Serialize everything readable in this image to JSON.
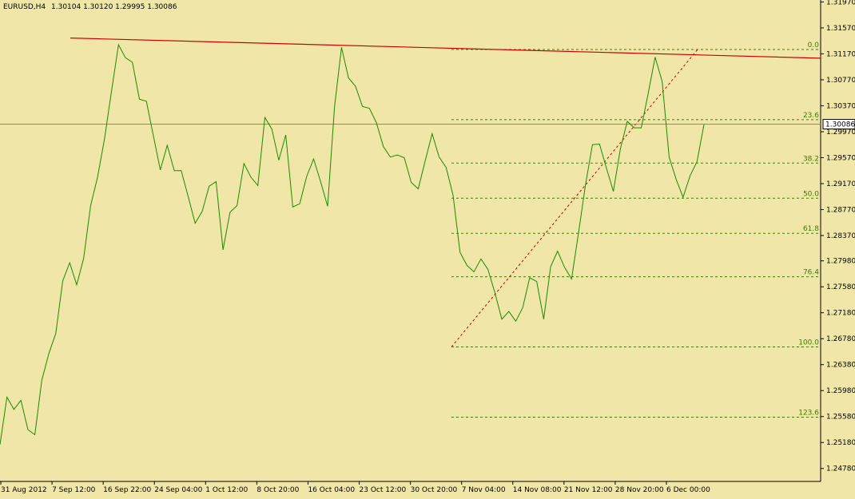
{
  "header": {
    "symbol": "EURUSD,H4",
    "ohlc": "1.30104 1.30120 1.29995 1.30086"
  },
  "current_price_label": "1.30086",
  "colors": {
    "background": "#efe6a8",
    "price_line": "#1a8c00",
    "trend_line": "#cc0000",
    "fib_level": "#2e8b00",
    "fib_diagonal": "#cc0000",
    "current_price_line": "#8a8a8a",
    "current_price_box_bg": "#ffffff"
  },
  "chart_data": {
    "type": "line",
    "title": "EURUSD,H4",
    "xlabel": "",
    "ylabel": "",
    "ylim": [
      1.2458,
      1.32
    ],
    "y_ticks": [
      "1.31970",
      "1.31570",
      "1.31170",
      "1.30770",
      "1.30370",
      "1.29970",
      "1.29570",
      "1.29170",
      "1.28770",
      "1.28370",
      "1.27980",
      "1.27580",
      "1.27180",
      "1.26780",
      "1.26380",
      "1.25980",
      "1.25580",
      "1.25180",
      "1.24780"
    ],
    "x_ticks": [
      "31 Aug 2012",
      "7 Sep 12:00",
      "16 Sep 22:00",
      "24 Sep 04:00",
      "1 Oct 12:00",
      "8 Oct 20:00",
      "16 Oct 04:00",
      "23 Oct 12:00",
      "30 Oct 20:00",
      "7 Nov 04:00",
      "14 Nov 08:00",
      "21 Nov 12:00",
      "28 Nov 20:00",
      "6 Dec 00:00"
    ],
    "series": [
      {
        "values": [
          1.2515,
          1.2588,
          1.2569,
          1.2583,
          1.2538,
          1.253,
          1.2614,
          1.2655,
          1.2686,
          1.2767,
          1.2795,
          1.2761,
          1.2802,
          1.2883,
          1.2927,
          1.2986,
          1.306,
          1.3131,
          1.3111,
          1.3104,
          1.3047,
          1.3044,
          1.2991,
          1.2938,
          1.2976,
          1.2937,
          1.2937,
          1.2897,
          1.2856,
          1.2874,
          1.2913,
          1.292,
          1.2815,
          1.2873,
          1.2883,
          1.2948,
          1.2927,
          1.2914,
          1.3019,
          1.3001,
          1.2953,
          1.2992,
          1.2881,
          1.2886,
          1.2928,
          1.2955,
          1.292,
          1.2882,
          1.3036,
          1.3127,
          1.308,
          1.3067,
          1.3036,
          1.3033,
          1.3011,
          1.2974,
          1.2958,
          1.2961,
          1.2957,
          1.2919,
          1.2909,
          1.2952,
          1.2994,
          1.2958,
          1.2942,
          1.2899,
          1.2811,
          1.2791,
          1.2781,
          1.2801,
          1.2785,
          1.2749,
          1.2708,
          1.272,
          1.2705,
          1.2726,
          1.2772,
          1.2766,
          1.2708,
          1.2789,
          1.2813,
          1.2788,
          1.277,
          1.2841,
          1.2915,
          1.2977,
          1.2978,
          1.2941,
          1.2905,
          1.297,
          1.3013,
          1.3003,
          1.3003,
          1.3056,
          1.3112,
          1.3074,
          1.2958,
          1.2924,
          1.2896,
          1.2929,
          1.2951,
          1.3008
        ]
      }
    ],
    "fib_levels": [
      {
        "label": "0.0",
        "value": 1.31237
      },
      {
        "label": "23.6",
        "value": 1.30155
      },
      {
        "label": "38.2",
        "value": 1.29486
      },
      {
        "label": "50.0",
        "value": 1.28945
      },
      {
        "label": "61.8",
        "value": 1.28404
      },
      {
        "label": "76.4",
        "value": 1.27735
      },
      {
        "label": "100.0",
        "value": 1.26653
      },
      {
        "label": "123.6",
        "value": 1.25571
      }
    ],
    "fib_anchor_low": 1.26653,
    "fib_anchor_high": 1.31237,
    "trend_line": {
      "start": 1.31414,
      "end": 1.31103
    },
    "current_price": 1.30086,
    "grid": false,
    "legend": "none"
  }
}
